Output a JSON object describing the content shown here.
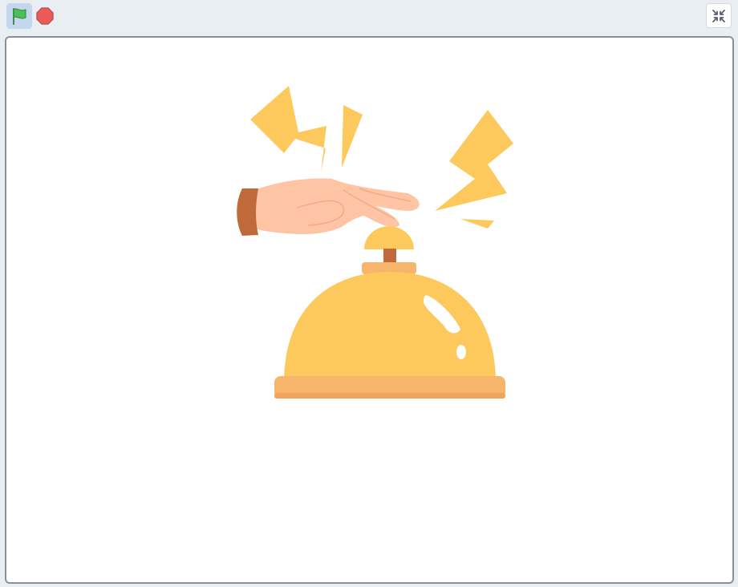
{
  "toolbar": {
    "green_flag": {
      "icon": "green-flag-icon",
      "color": "#4cbf56",
      "active_bg": "#c5d6ef"
    },
    "stop": {
      "icon": "stop-icon",
      "color": "#ec5959"
    },
    "fullscreen_toggle": {
      "icon": "unfullscreen-icon"
    }
  },
  "stage": {
    "background": "#ffffff",
    "sprite": {
      "name_icon": "hand-ringing-service-bell",
      "colors": {
        "bell": "#fdc95d",
        "bell_base": "#f6b56b",
        "bell_stem": "#c0693a",
        "hand": "#ffc4a3",
        "cuff": "#c0693a",
        "sparks": "#fdc95d"
      }
    }
  }
}
